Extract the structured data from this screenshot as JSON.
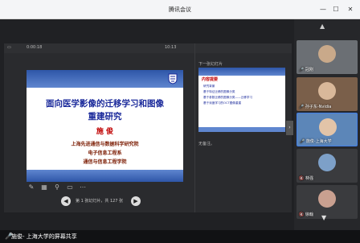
{
  "window": {
    "title": "腾讯会议"
  },
  "ppt": {
    "toolbar": {
      "left": "0:00:18",
      "right": "10:13"
    },
    "slide": {
      "title_line1": "面向医学影像的迁移学习和图像",
      "title_line2": "重建研究",
      "presenter": "施 俊",
      "affiliations": [
        "上海先进通信与数据科学研究院",
        "电子信息工程系",
        "通信与信息工程学院"
      ]
    },
    "page_count": "第 1 张幻灯片，共 127 张",
    "next_label": "下一张幻灯片",
    "next_slide": {
      "heading": "内容提要",
      "lines": [
        "研究背景",
        "基于特征迁移的图像分类",
        "基于参数迁移的图像分类——迁移学习",
        "基于深度学习的OCT图像重建"
      ]
    },
    "notes_placeholder": "无备注。"
  },
  "participants": [
    {
      "name": "冠刚",
      "mic": "on"
    },
    {
      "name": "孙子东-Nvidia",
      "mic": "on"
    },
    {
      "name": "施俊-上海大学",
      "mic": "on"
    },
    {
      "name": "林强",
      "mic": "off"
    },
    {
      "name": "徐翰",
      "mic": "off"
    }
  ],
  "status": {
    "sharing_text": "施俊- 上海大学的屏幕共享"
  },
  "colors": {
    "slide_blue": "#1b2a9b",
    "slide_red": "#c00000",
    "band": "#2e56a8"
  }
}
